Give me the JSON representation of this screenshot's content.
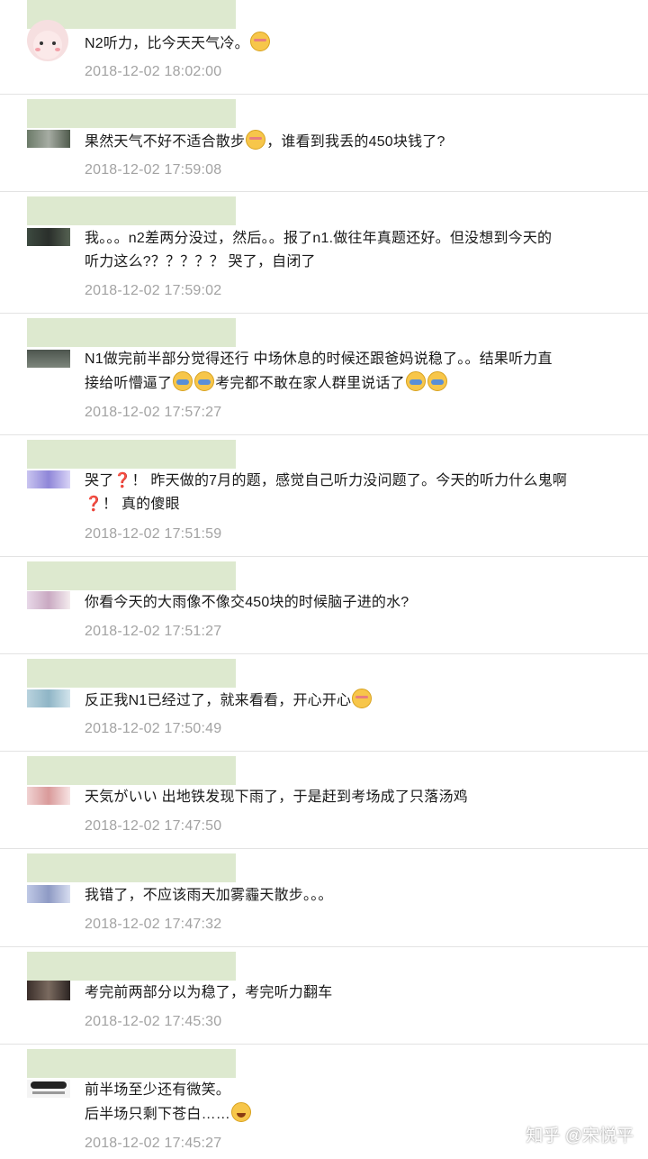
{
  "comments": [
    {
      "text": "N2听力，比今天天气冷。",
      "time": "2018-12-02 18:02:00"
    },
    {
      "text_a": "果然天气不好不适合散步",
      "text_b": "，谁看到我丢的450块钱了?",
      "time": "2018-12-02 17:59:08"
    },
    {
      "line1": "我。。。n2差两分没过，然后。。报了n1.做往年真题还好。但没想到今天的",
      "line2": "听力这么?？？？？？ 哭了，自闭了",
      "time": "2018-12-02 17:59:02"
    },
    {
      "line1": "N1做完前半部分觉得还行 中场休息的时候还跟爸妈说稳了。。结果听力直",
      "line2_a": "接给听懵逼了",
      "line2_b": "考完都不敢在家人群里说话了",
      "time": "2018-12-02 17:57:27"
    },
    {
      "line1_a": "哭了",
      "q1": "❓",
      "line1_b": "！ 昨天做的7月的题，感觉自己听力没问题了。今天的听力什么鬼啊",
      "q2": "❓",
      "line2": "！ 真的傻眼",
      "time": "2018-12-02 17:51:59"
    },
    {
      "text": "你看今天的大雨像不像交450块的时候脑子进的水?",
      "time": "2018-12-02 17:51:27"
    },
    {
      "text": "反正我N1已经过了，就来看看，开心开心",
      "time": "2018-12-02 17:50:49"
    },
    {
      "text": "天気がいい 出地铁发现下雨了，于是赶到考场成了只落汤鸡",
      "time": "2018-12-02 17:47:50"
    },
    {
      "text": "我错了，不应该雨天加雾霾天散步。。。",
      "time": "2018-12-02 17:47:32"
    },
    {
      "text": "考完前两部分以为稳了，考完听力翻车",
      "time": "2018-12-02 17:45:30"
    },
    {
      "line1": "前半场至少还有微笑。",
      "line2": "后半场只剩下苍白……",
      "time": "2018-12-02 17:45:27"
    }
  ],
  "watermark": "知乎 @宋悦平",
  "colors": {
    "name_mask": "#dde9cf",
    "time": "#a3a3a3",
    "divider": "#e3e3e3"
  }
}
